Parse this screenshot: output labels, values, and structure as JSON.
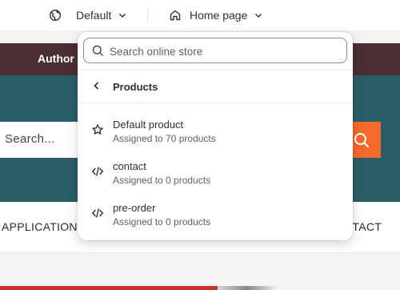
{
  "topbar": {
    "theme_label": "Default",
    "page_label": "Home page"
  },
  "preview": {
    "menu_author": "Author",
    "search_placeholder": "Search...",
    "nav_left": "APPLICATION",
    "nav_right": "NTACT",
    "colors": {
      "menubar": "#4a2e33",
      "teal": "#2b5d66",
      "accent": "#f26a2c"
    }
  },
  "popover": {
    "search_placeholder": "Search online store",
    "back_title": "Products",
    "items": [
      {
        "name": "Default product",
        "sub": "Assigned to 70 products",
        "icon": "star-icon"
      },
      {
        "name": "contact",
        "sub": "Assigned to 0 products",
        "icon": "code-icon"
      },
      {
        "name": "pre-order",
        "sub": "Assigned to 0 products",
        "icon": "code-icon"
      }
    ]
  }
}
